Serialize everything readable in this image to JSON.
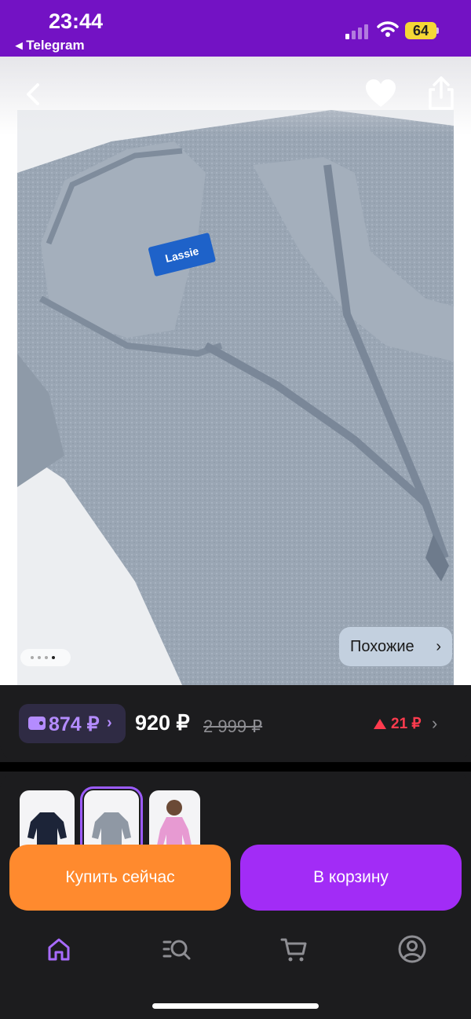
{
  "status_bar": {
    "time": "23:44",
    "back_app": "◂ Telegram",
    "battery": "64"
  },
  "product_image": {
    "page_count": 4,
    "active_page": 4,
    "similar_label": "Похожие",
    "brand_tag": "Lassie"
  },
  "price": {
    "wallet_amount": "874 ₽",
    "current": "920 ₽",
    "old": "2 999 ₽",
    "change": "21 ₽"
  },
  "variants": [
    {
      "color": "#1c2438"
    },
    {
      "color": "#8f98a4"
    },
    {
      "color": "#e79ad2"
    }
  ],
  "actions": {
    "buy_now": "Купить сейчас",
    "add_to_cart": "В корзину"
  },
  "tabbar": {
    "items": [
      {
        "icon": "home-icon",
        "active": true
      },
      {
        "icon": "catalog-search-icon",
        "active": false
      },
      {
        "icon": "cart-icon",
        "active": false
      },
      {
        "icon": "profile-icon",
        "active": false
      }
    ]
  },
  "colors": {
    "accent": "#a22cf6",
    "buy": "#ff8a2e",
    "status_bar": "#7312c4",
    "price_up": "#ff3b4e"
  }
}
